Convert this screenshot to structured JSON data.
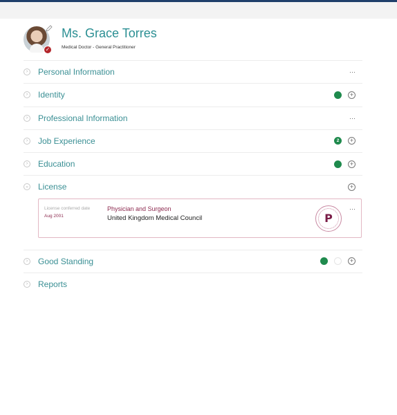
{
  "profile": {
    "name": "Ms. Grace Torres",
    "role": "Medical Doctor - General Practitioner",
    "verified_icon": "check-badge-icon",
    "colors": {
      "name": "#2b8f93",
      "verified": "#b3262b"
    }
  },
  "sections": [
    {
      "title": "Personal Information",
      "status": "more"
    },
    {
      "title": "Identity",
      "status": "green-dot",
      "action": "add"
    },
    {
      "title": "Professional Information",
      "status": "more"
    },
    {
      "title": "Job Experience",
      "status": "green-count",
      "count": "2",
      "action": "add"
    },
    {
      "title": "Education",
      "status": "green-dot",
      "action": "add"
    },
    {
      "title": "License",
      "expanded": true,
      "action": "add"
    },
    {
      "title": "Good Standing",
      "status": "green-and-empty",
      "action": "add"
    },
    {
      "title": "Reports"
    }
  ],
  "license": {
    "label": "License conferred date",
    "date": "Aug 2001",
    "title": "Physician and Surgeon",
    "organization": "United Kingdom Medical Council",
    "badge_letter": "P",
    "more_label": "···"
  },
  "more_label": "···",
  "plus_label": "+",
  "chevron_right": "›",
  "chevron_down": "⌄",
  "colors": {
    "accent": "#3a8f94",
    "status_green": "#1f8a4d",
    "license": "#8c2a4f",
    "header_bar": "#1f3f6b"
  }
}
